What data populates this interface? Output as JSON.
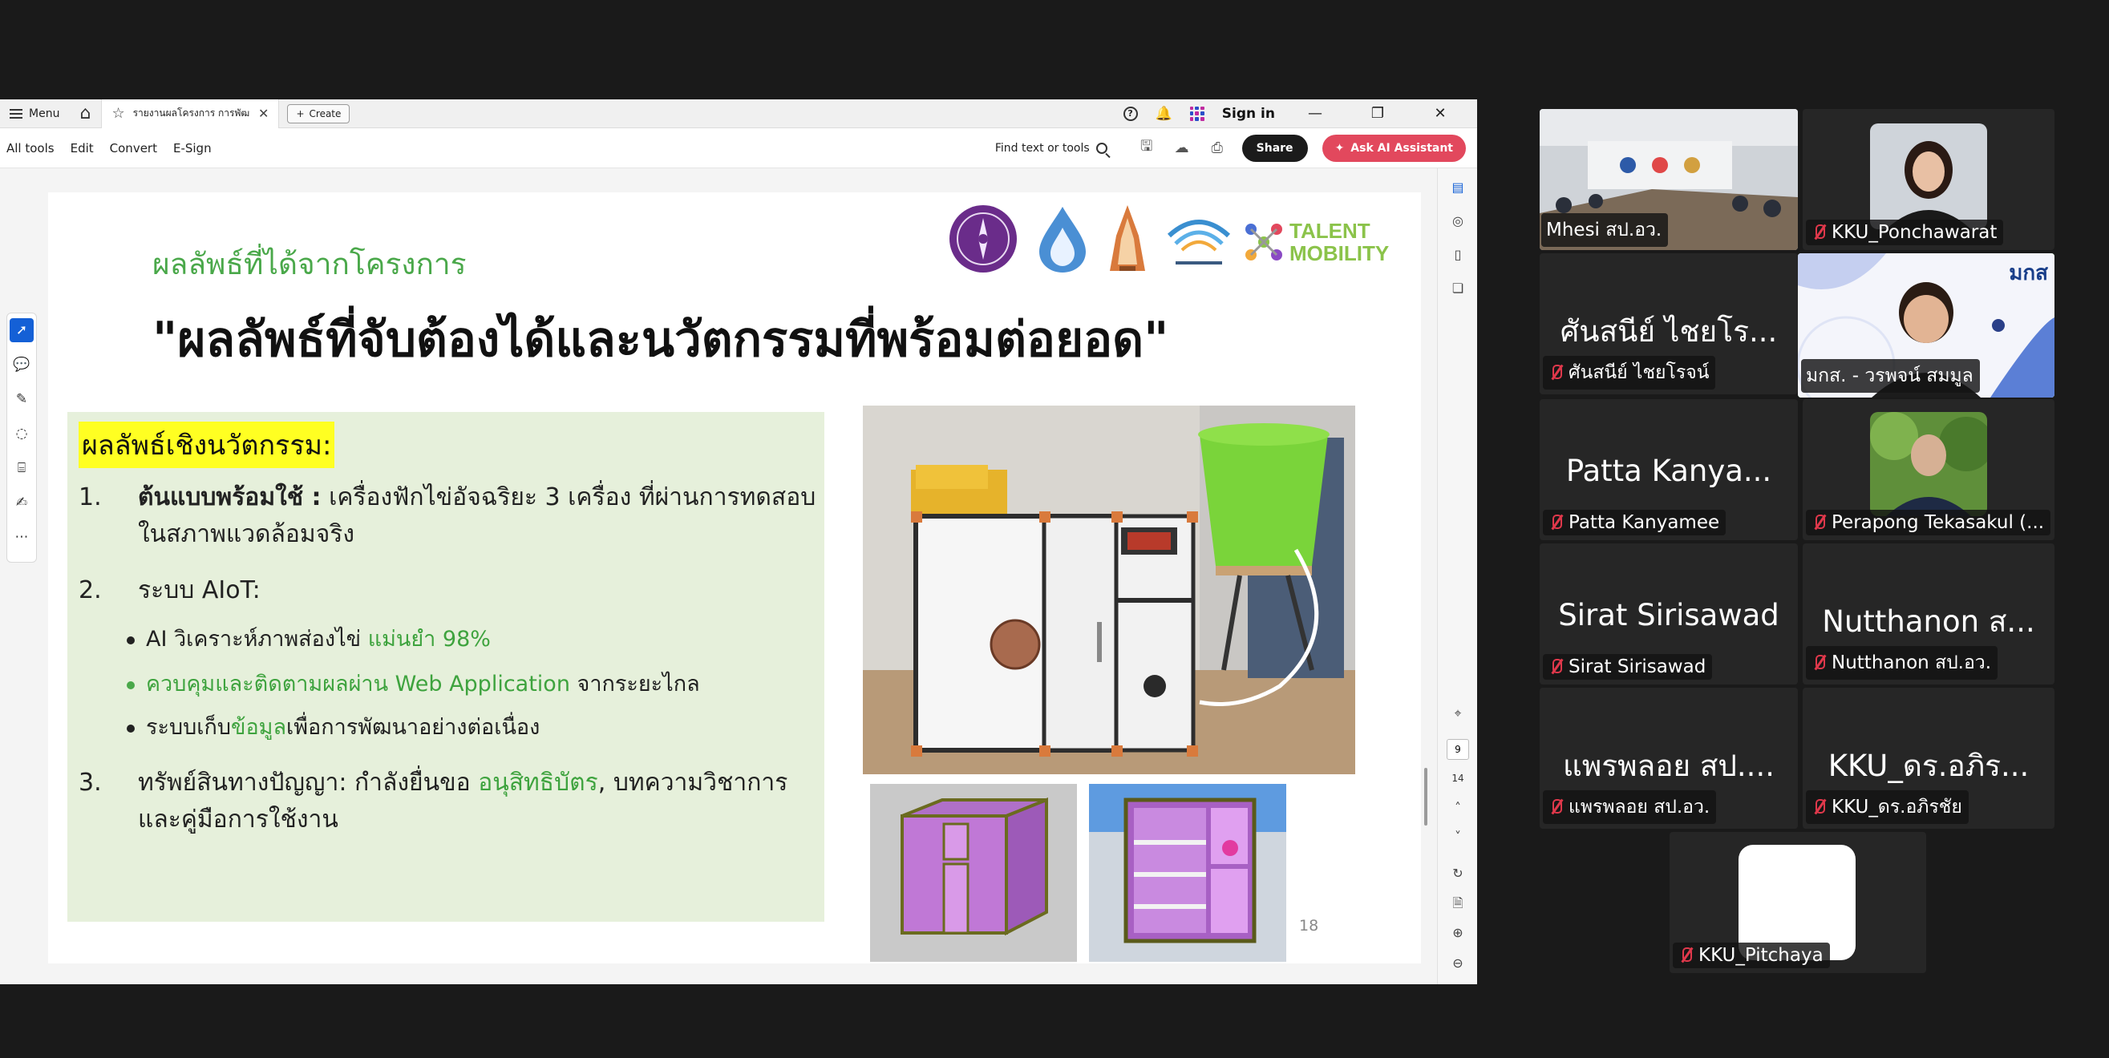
{
  "acrobat": {
    "menu_label": "Menu",
    "tab_title": "รายงานผลโครงการ การพัฒนา...",
    "create_label": "Create",
    "help_icon_text": "?",
    "signin_label": "Sign in",
    "tool_tabs": [
      "All tools",
      "Edit",
      "Convert",
      "E-Sign"
    ],
    "find_label": "Find text or tools",
    "share_label": "Share",
    "ai_label": "Ask AI Assistant",
    "current_page": "9",
    "total_pages": "14",
    "accent": "#1460d6",
    "ai_color": "#e2485d"
  },
  "slide": {
    "subtitle": "ผลลัพธ์ที่ได้จากโครงการ",
    "title": "\"ผลลัพธ์ที่จับต้องได้และนวัตกรรมที่พร้อมต่อยอด\"",
    "talent_logo": [
      "TALENT",
      "MOBILITY"
    ],
    "innov_heading": "ผลลัพธ์เชิงนวัตกรรม:",
    "items": [
      {
        "num": "1.",
        "bold": "ต้นแบบพร้อมใช้ :",
        "text": " เครื่องฟักไข่อัจฉริยะ 3 เครื่อง ที่ผ่านการทดสอบในสภาพแวดล้อมจริง"
      },
      {
        "num": "2.",
        "text": "ระบบ AIoT:"
      },
      {
        "num": "3.",
        "text_a": "ทรัพย์สินทางปัญญา: กำลังยื่นขอ ",
        "green": "อนุสิทธิบัตร",
        "text_b": ", บทความวิชาการและคู่มือการใช้งาน"
      }
    ],
    "bullets": [
      {
        "a": "AI วิเคราะห์ภาพส่องไข่ ",
        "green": "แม่นยำ 98%",
        "b": ""
      },
      {
        "a": "",
        "green": "ควบคุมและติดตามผลผ่าน Web Application",
        "b": " จากระยะไกล"
      },
      {
        "a": "ระบบเก็บ",
        "green": "ข้อมูล",
        "b": "เพื่อการพัฒนาอย่างต่อเนื่อง"
      }
    ],
    "page_number": "18",
    "green": "#4aa84a",
    "highlight": "#ffff22"
  },
  "participants": [
    {
      "name": "Mhesi สป.อว.",
      "big": "",
      "video": "meeting-room"
    },
    {
      "name": "KKU_Ponchawarat",
      "big": "",
      "video": "photo-woman"
    },
    {
      "name": "ศันสนีย์ ไชยโรจน์",
      "big": "ศันสนีย์ ไชยโร..."
    },
    {
      "name": "มกส. - วรพจน์ สมมูล",
      "big": "",
      "video": "live-speaker",
      "logo": "มกส"
    },
    {
      "name": "Patta Kanyamee",
      "big": "Patta Kanya..."
    },
    {
      "name": "Perapong Tekasakul (...",
      "big": "",
      "video": "photo-man"
    },
    {
      "name": "Sirat Sirisawad",
      "big": "Sirat Sirisawad"
    },
    {
      "name": "Nutthanon สป.อว.",
      "big": "Nutthanon ส..."
    },
    {
      "name": "แพรพลอย สป.อว.",
      "big": "แพรพลอย สป...."
    },
    {
      "name": "KKU_ดร.อภิรชัย",
      "big": "KKU_ดร.อภิร..."
    },
    {
      "name": "KKU_Pitchaya",
      "big": "",
      "video": "white-avatar"
    }
  ],
  "colors": {
    "active_speaker": "#5ed95e",
    "muted_icon": "#e0384b"
  }
}
